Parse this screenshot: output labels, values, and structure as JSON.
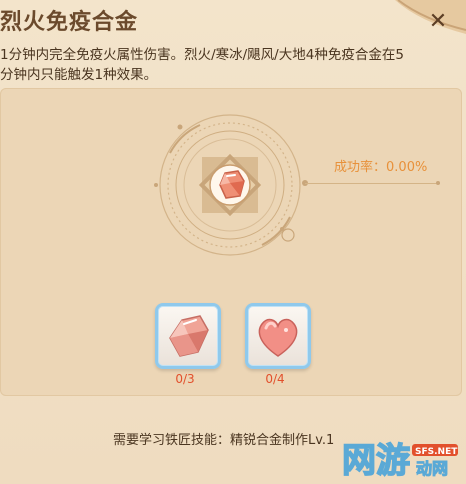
{
  "window": {
    "title": "烈火免疫合金",
    "close_symbol": "✕"
  },
  "description": {
    "line1": "1分钟内完全免疫火属性伤害。烈火/寒冰/飓风/大地4种免疫合金在5",
    "line2": "分钟内只能触发1种效果。"
  },
  "craft": {
    "success_rate_label": "成功率：",
    "success_rate_value": "0.00%",
    "result_icon": "orange-crystal-icon"
  },
  "materials": [
    {
      "icon": "pink-crystal-icon",
      "count": "0/3"
    },
    {
      "icon": "pink-heart-stone-icon",
      "count": "0/4"
    }
  ],
  "footer": {
    "requirement": "需要学习铁匠技能：精锐合金制作Lv.1"
  },
  "watermark": {
    "logo_text": "网游",
    "sub_text": "动网",
    "domain": "SFS.NET"
  },
  "colors": {
    "panel_bg": "#efdcc0",
    "success_rate": "#e8913a",
    "count": "#e2502c",
    "slot_border": "#8fc9ec"
  }
}
